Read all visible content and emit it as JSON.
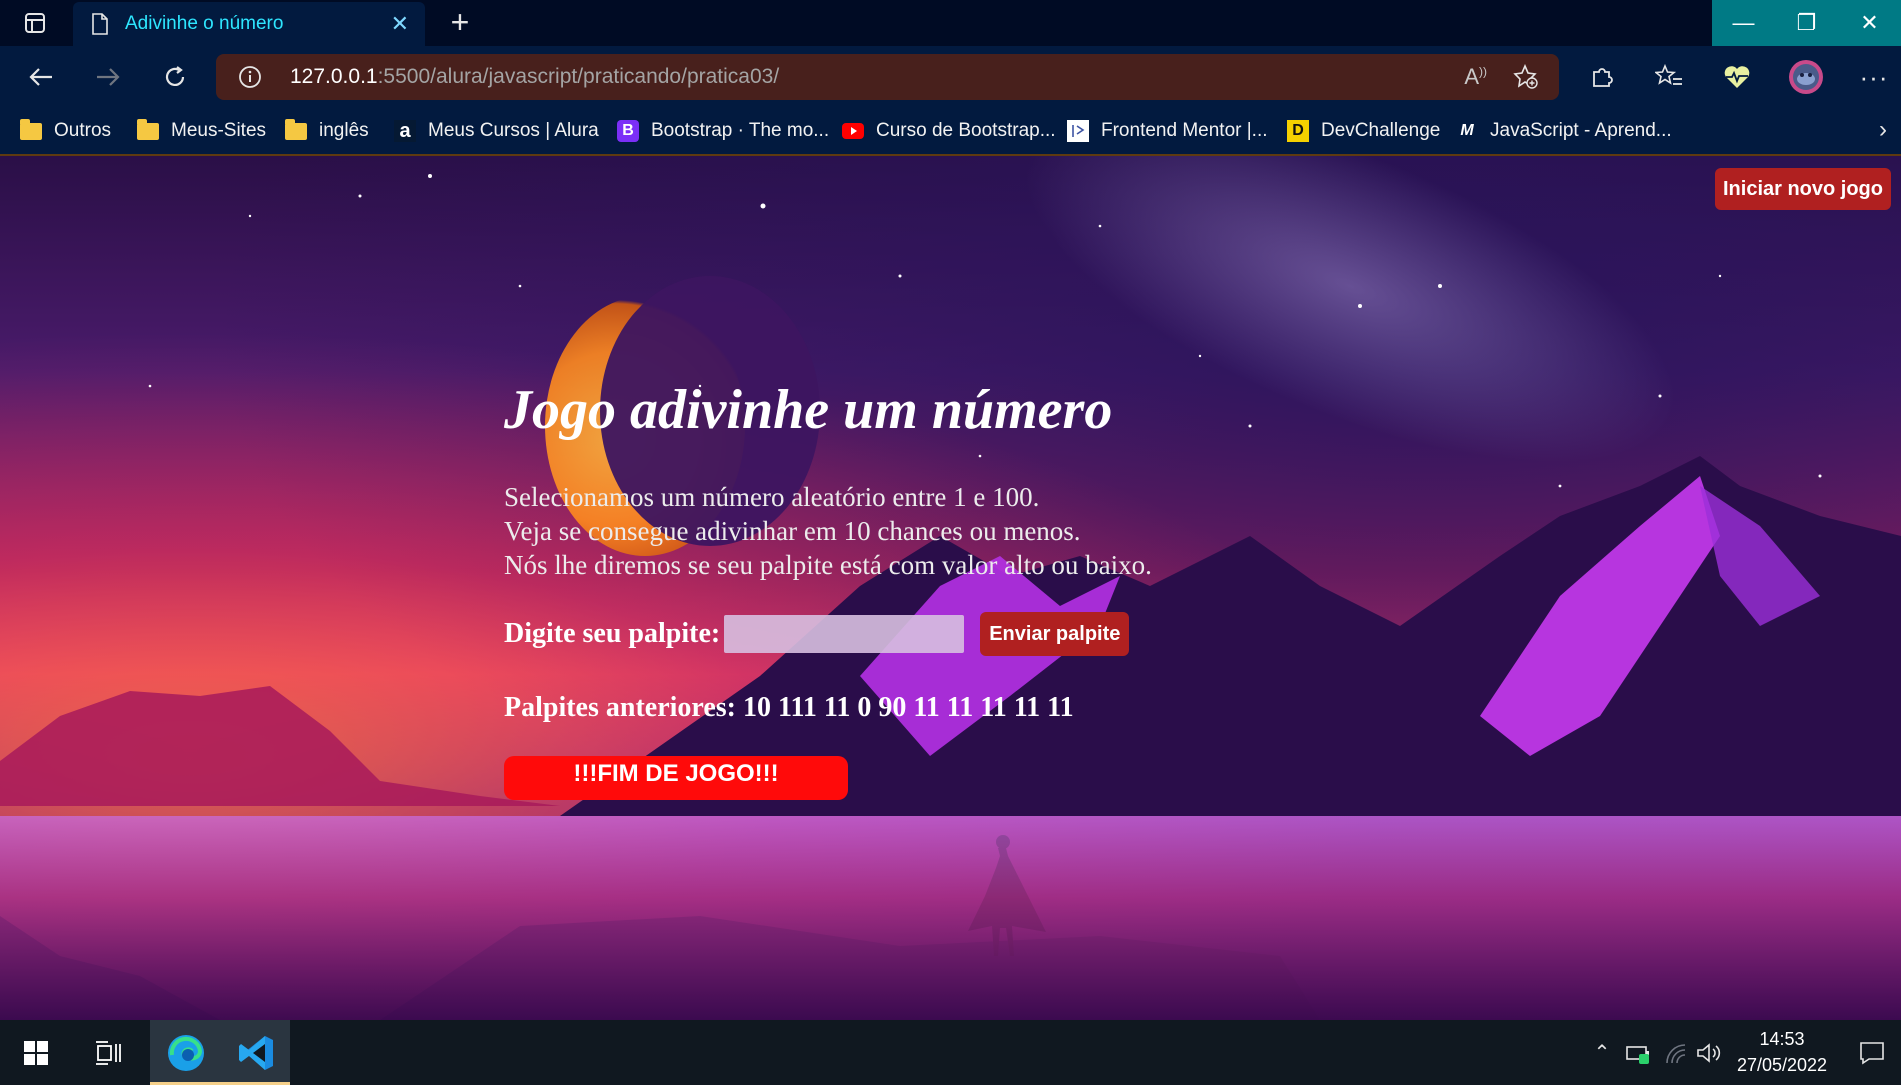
{
  "browser": {
    "tab_title": "Adivinhe o número",
    "url_host": "127.0.0.1",
    "url_path": ":5500/alura/javascript/praticando/pratica03/",
    "read_aloud_label": "A⁾"
  },
  "bookmarks": [
    {
      "label": "Outros",
      "icon": "folder-icon"
    },
    {
      "label": "Meus-Sites",
      "icon": "folder-icon"
    },
    {
      "label": "inglês",
      "icon": "folder-icon"
    },
    {
      "label": "Meus Cursos | Alura",
      "icon": "alura-icon",
      "glyph": "a"
    },
    {
      "label": "Bootstrap · The mo...",
      "icon": "bootstrap-icon",
      "glyph": "B",
      "color": "#7b2ff7"
    },
    {
      "label": "Curso de Bootstrap...",
      "icon": "youtube-icon",
      "color": "#ff0000"
    },
    {
      "label": "Frontend Mentor |...",
      "icon": "frontend-mentor-icon"
    },
    {
      "label": "DevChallenge",
      "icon": "devchallenge-icon",
      "glyph": "D",
      "color": "#f5d000"
    },
    {
      "label": "JavaScript - Aprend...",
      "icon": "mdn-icon",
      "glyph": "M"
    }
  ],
  "page": {
    "new_game_button": "Iniciar novo jogo",
    "title": "Jogo adivinhe um número",
    "intro_lines": [
      "Selecionamos um número aleatório entre 1 e 100.",
      "Veja se consegue adivinhar em 10 chances ou menos.",
      "Nós lhe diremos se seu palpite está com valor alto ou baixo."
    ],
    "guess_label": "Digite seu palpite:",
    "guess_value": "",
    "send_button": "Enviar palpite",
    "history_text": "Palpites anteriores: 10 111 11 0 90 11 11 11 11 11",
    "game_over_text": "!!!FIM DE JOGO!!!"
  },
  "taskbar": {
    "time": "14:53",
    "date": "27/05/2022"
  },
  "colors": {
    "accent_button": "#b02020",
    "game_over": "#ff0a0a",
    "tab_title": "#2ee6ff",
    "url_bar": "#48201c"
  }
}
